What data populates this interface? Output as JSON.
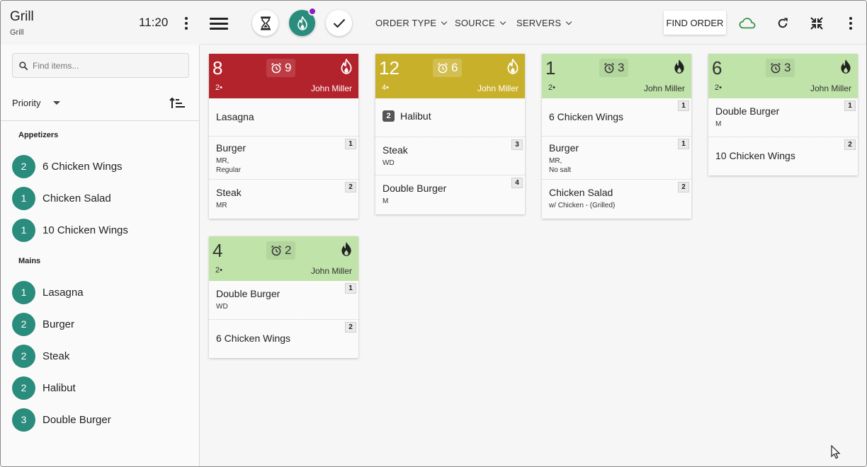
{
  "station": {
    "name": "Grill",
    "subtitle": "Grill",
    "time": "11:20"
  },
  "search": {
    "placeholder": "Find items..."
  },
  "sort": {
    "label": "Priority"
  },
  "sidebar": {
    "sections": [
      {
        "title": "Appetizers",
        "items": [
          {
            "count": "2",
            "label": "6 Chicken Wings"
          },
          {
            "count": "1",
            "label": "Chicken Salad"
          },
          {
            "count": "1",
            "label": "10 Chicken Wings"
          }
        ]
      },
      {
        "title": "Mains",
        "items": [
          {
            "count": "1",
            "label": "Lasagna"
          },
          {
            "count": "2",
            "label": "Burger"
          },
          {
            "count": "2",
            "label": "Steak"
          },
          {
            "count": "2",
            "label": "Halibut"
          },
          {
            "count": "3",
            "label": "Double Burger"
          }
        ]
      }
    ]
  },
  "topbar": {
    "filters": [
      "ORDER TYPE",
      "SOURCE",
      "SERVERS"
    ],
    "find_order": "FIND ORDER"
  },
  "colors": {
    "accent": "#2a8c7c",
    "red": "#b3232c",
    "yellow": "#c9b02b",
    "green": "#bfe3a8",
    "notification": "#8b1fb8"
  },
  "tickets": [
    {
      "number": "8",
      "timer": "9",
      "guests": "2",
      "server": "John Miller",
      "status": "red",
      "items": [
        {
          "name": "Lasagna",
          "seat": "",
          "qty": "",
          "mods": []
        },
        {
          "name": "Burger",
          "seat": "1",
          "qty": "",
          "mods": [
            "MR,",
            "Regular"
          ]
        },
        {
          "name": "Steak",
          "seat": "2",
          "qty": "",
          "mods": [
            "MR"
          ]
        }
      ]
    },
    {
      "number": "12",
      "timer": "6",
      "guests": "4",
      "server": "John Miller",
      "status": "yellow",
      "items": [
        {
          "name": "Halibut",
          "seat": "",
          "qty": "2",
          "mods": []
        },
        {
          "name": "Steak",
          "seat": "3",
          "qty": "",
          "mods": [
            "WD"
          ]
        },
        {
          "name": "Double Burger",
          "seat": "4",
          "qty": "",
          "mods": [
            "M"
          ]
        }
      ]
    },
    {
      "number": "1",
      "timer": "3",
      "guests": "2",
      "server": "John Miller",
      "status": "green",
      "items": [
        {
          "name": "6 Chicken Wings",
          "seat": "1",
          "qty": "",
          "mods": []
        },
        {
          "name": "Burger",
          "seat": "1",
          "qty": "",
          "mods": [
            "MR,",
            "No salt"
          ]
        },
        {
          "name": "Chicken Salad",
          "seat": "2",
          "qty": "",
          "mods": [
            "w/ Chicken - (Grilled)"
          ]
        }
      ]
    },
    {
      "number": "6",
      "timer": "3",
      "guests": "2",
      "server": "John Miller",
      "status": "green",
      "items": [
        {
          "name": "Double Burger",
          "seat": "1",
          "qty": "",
          "mods": [
            "M"
          ]
        },
        {
          "name": "10 Chicken Wings",
          "seat": "2",
          "qty": "",
          "mods": []
        }
      ]
    },
    {
      "number": "4",
      "timer": "2",
      "guests": "2",
      "server": "John Miller",
      "status": "green",
      "items": [
        {
          "name": "Double Burger",
          "seat": "1",
          "qty": "",
          "mods": [
            "WD"
          ]
        },
        {
          "name": "6 Chicken Wings",
          "seat": "2",
          "qty": "",
          "mods": []
        }
      ]
    }
  ]
}
